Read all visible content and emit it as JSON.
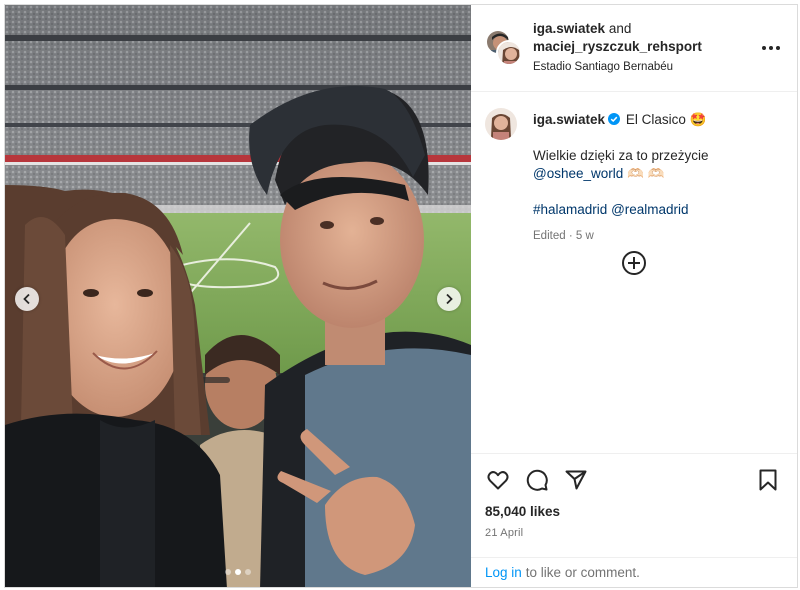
{
  "post": {
    "author": "iga.swiatek",
    "conjunction": "and",
    "coauthor": "maciej_ryszczuk_rehsport",
    "location": "Estadio Santiago Bernabéu"
  },
  "caption": {
    "username": "iga.swiatek",
    "title": "El Clasico",
    "title_emoji": "🤩",
    "text": "Wielkie dzięki za to przeżycie",
    "mention": "@oshee_world",
    "mention_emoji": "🫶🏻 🫶🏻",
    "hashtag1": "#halamadrid",
    "hashtag2": "@realmadrid",
    "edited": "Edited",
    "separator": "·",
    "age": "5 w"
  },
  "stats": {
    "likes": "85,040 likes",
    "date": "21 April"
  },
  "login": {
    "link": "Log in",
    "text": "to like or comment."
  },
  "carousel": {
    "slide_count": 3,
    "active_slide": 1
  },
  "icons": [
    "heart-icon",
    "comment-icon",
    "share-icon",
    "bookmark-icon",
    "more-options-icon",
    "add-circle-icon",
    "verified-icon",
    "chevron-left-icon",
    "chevron-right-icon"
  ],
  "colors": {
    "link": "#00376b",
    "login": "#0095f6",
    "verified": "#0095f6",
    "muted": "#737373",
    "text": "#262626"
  }
}
